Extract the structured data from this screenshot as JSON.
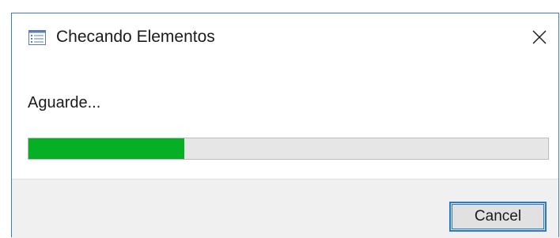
{
  "window": {
    "title": "Checando Elementos",
    "icon": "list-window-icon",
    "close_icon": "close-icon"
  },
  "body": {
    "message": "Aguarde..."
  },
  "progress": {
    "value_percent": 30,
    "fill_color": "#06b025",
    "track_color": "#e6e6e6"
  },
  "footer": {
    "cancel_label": "Cancel"
  },
  "colors": {
    "accent": "#2a7ad0",
    "window_border": "#3c7fb1",
    "footer_bg": "#f0f0f0"
  }
}
